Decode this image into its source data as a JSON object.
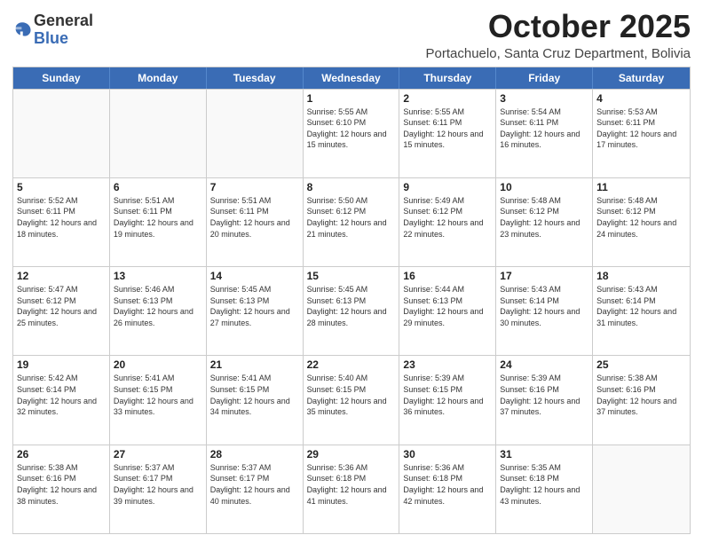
{
  "logo": {
    "general": "General",
    "blue": "Blue"
  },
  "header": {
    "month": "October 2025",
    "location": "Portachuelo, Santa Cruz Department, Bolivia"
  },
  "weekdays": [
    "Sunday",
    "Monday",
    "Tuesday",
    "Wednesday",
    "Thursday",
    "Friday",
    "Saturday"
  ],
  "rows": [
    [
      {
        "day": "",
        "sunrise": "",
        "sunset": "",
        "daylight": ""
      },
      {
        "day": "",
        "sunrise": "",
        "sunset": "",
        "daylight": ""
      },
      {
        "day": "",
        "sunrise": "",
        "sunset": "",
        "daylight": ""
      },
      {
        "day": "1",
        "sunrise": "Sunrise: 5:55 AM",
        "sunset": "Sunset: 6:10 PM",
        "daylight": "Daylight: 12 hours and 15 minutes."
      },
      {
        "day": "2",
        "sunrise": "Sunrise: 5:55 AM",
        "sunset": "Sunset: 6:11 PM",
        "daylight": "Daylight: 12 hours and 15 minutes."
      },
      {
        "day": "3",
        "sunrise": "Sunrise: 5:54 AM",
        "sunset": "Sunset: 6:11 PM",
        "daylight": "Daylight: 12 hours and 16 minutes."
      },
      {
        "day": "4",
        "sunrise": "Sunrise: 5:53 AM",
        "sunset": "Sunset: 6:11 PM",
        "daylight": "Daylight: 12 hours and 17 minutes."
      }
    ],
    [
      {
        "day": "5",
        "sunrise": "Sunrise: 5:52 AM",
        "sunset": "Sunset: 6:11 PM",
        "daylight": "Daylight: 12 hours and 18 minutes."
      },
      {
        "day": "6",
        "sunrise": "Sunrise: 5:51 AM",
        "sunset": "Sunset: 6:11 PM",
        "daylight": "Daylight: 12 hours and 19 minutes."
      },
      {
        "day": "7",
        "sunrise": "Sunrise: 5:51 AM",
        "sunset": "Sunset: 6:11 PM",
        "daylight": "Daylight: 12 hours and 20 minutes."
      },
      {
        "day": "8",
        "sunrise": "Sunrise: 5:50 AM",
        "sunset": "Sunset: 6:12 PM",
        "daylight": "Daylight: 12 hours and 21 minutes."
      },
      {
        "day": "9",
        "sunrise": "Sunrise: 5:49 AM",
        "sunset": "Sunset: 6:12 PM",
        "daylight": "Daylight: 12 hours and 22 minutes."
      },
      {
        "day": "10",
        "sunrise": "Sunrise: 5:48 AM",
        "sunset": "Sunset: 6:12 PM",
        "daylight": "Daylight: 12 hours and 23 minutes."
      },
      {
        "day": "11",
        "sunrise": "Sunrise: 5:48 AM",
        "sunset": "Sunset: 6:12 PM",
        "daylight": "Daylight: 12 hours and 24 minutes."
      }
    ],
    [
      {
        "day": "12",
        "sunrise": "Sunrise: 5:47 AM",
        "sunset": "Sunset: 6:12 PM",
        "daylight": "Daylight: 12 hours and 25 minutes."
      },
      {
        "day": "13",
        "sunrise": "Sunrise: 5:46 AM",
        "sunset": "Sunset: 6:13 PM",
        "daylight": "Daylight: 12 hours and 26 minutes."
      },
      {
        "day": "14",
        "sunrise": "Sunrise: 5:45 AM",
        "sunset": "Sunset: 6:13 PM",
        "daylight": "Daylight: 12 hours and 27 minutes."
      },
      {
        "day": "15",
        "sunrise": "Sunrise: 5:45 AM",
        "sunset": "Sunset: 6:13 PM",
        "daylight": "Daylight: 12 hours and 28 minutes."
      },
      {
        "day": "16",
        "sunrise": "Sunrise: 5:44 AM",
        "sunset": "Sunset: 6:13 PM",
        "daylight": "Daylight: 12 hours and 29 minutes."
      },
      {
        "day": "17",
        "sunrise": "Sunrise: 5:43 AM",
        "sunset": "Sunset: 6:14 PM",
        "daylight": "Daylight: 12 hours and 30 minutes."
      },
      {
        "day": "18",
        "sunrise": "Sunrise: 5:43 AM",
        "sunset": "Sunset: 6:14 PM",
        "daylight": "Daylight: 12 hours and 31 minutes."
      }
    ],
    [
      {
        "day": "19",
        "sunrise": "Sunrise: 5:42 AM",
        "sunset": "Sunset: 6:14 PM",
        "daylight": "Daylight: 12 hours and 32 minutes."
      },
      {
        "day": "20",
        "sunrise": "Sunrise: 5:41 AM",
        "sunset": "Sunset: 6:15 PM",
        "daylight": "Daylight: 12 hours and 33 minutes."
      },
      {
        "day": "21",
        "sunrise": "Sunrise: 5:41 AM",
        "sunset": "Sunset: 6:15 PM",
        "daylight": "Daylight: 12 hours and 34 minutes."
      },
      {
        "day": "22",
        "sunrise": "Sunrise: 5:40 AM",
        "sunset": "Sunset: 6:15 PM",
        "daylight": "Daylight: 12 hours and 35 minutes."
      },
      {
        "day": "23",
        "sunrise": "Sunrise: 5:39 AM",
        "sunset": "Sunset: 6:15 PM",
        "daylight": "Daylight: 12 hours and 36 minutes."
      },
      {
        "day": "24",
        "sunrise": "Sunrise: 5:39 AM",
        "sunset": "Sunset: 6:16 PM",
        "daylight": "Daylight: 12 hours and 37 minutes."
      },
      {
        "day": "25",
        "sunrise": "Sunrise: 5:38 AM",
        "sunset": "Sunset: 6:16 PM",
        "daylight": "Daylight: 12 hours and 37 minutes."
      }
    ],
    [
      {
        "day": "26",
        "sunrise": "Sunrise: 5:38 AM",
        "sunset": "Sunset: 6:16 PM",
        "daylight": "Daylight: 12 hours and 38 minutes."
      },
      {
        "day": "27",
        "sunrise": "Sunrise: 5:37 AM",
        "sunset": "Sunset: 6:17 PM",
        "daylight": "Daylight: 12 hours and 39 minutes."
      },
      {
        "day": "28",
        "sunrise": "Sunrise: 5:37 AM",
        "sunset": "Sunset: 6:17 PM",
        "daylight": "Daylight: 12 hours and 40 minutes."
      },
      {
        "day": "29",
        "sunrise": "Sunrise: 5:36 AM",
        "sunset": "Sunset: 6:18 PM",
        "daylight": "Daylight: 12 hours and 41 minutes."
      },
      {
        "day": "30",
        "sunrise": "Sunrise: 5:36 AM",
        "sunset": "Sunset: 6:18 PM",
        "daylight": "Daylight: 12 hours and 42 minutes."
      },
      {
        "day": "31",
        "sunrise": "Sunrise: 5:35 AM",
        "sunset": "Sunset: 6:18 PM",
        "daylight": "Daylight: 12 hours and 43 minutes."
      },
      {
        "day": "",
        "sunrise": "",
        "sunset": "",
        "daylight": ""
      }
    ]
  ]
}
